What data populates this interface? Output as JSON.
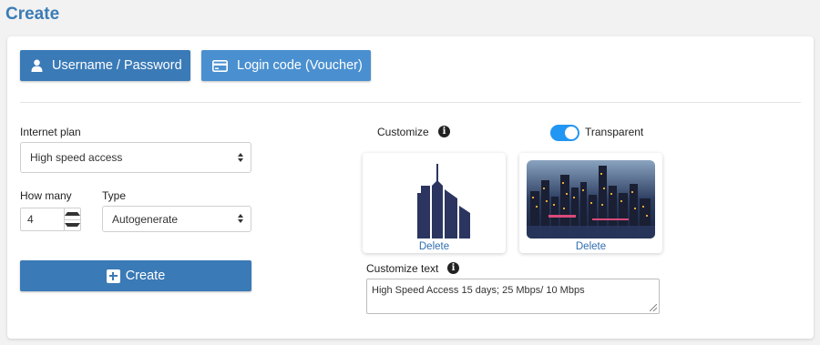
{
  "page": {
    "title": "Create"
  },
  "tabs": [
    {
      "label": "Username / Password",
      "icon": "user-icon"
    },
    {
      "label": "Login code (Voucher)",
      "icon": "credit-card-icon"
    }
  ],
  "form": {
    "plan_label": "Internet plan",
    "plan_value": "High speed access",
    "how_many_label": "How many",
    "how_many_value": "4",
    "type_label": "Type",
    "type_value": "Autogenerate",
    "create_label": "Create"
  },
  "customize": {
    "label": "Customize",
    "transparent_label": "Transparent",
    "transparent_on": true,
    "logo_delete": "Delete",
    "background_delete": "Delete",
    "text_label": "Customize text",
    "text_value": "High Speed Access 15 days; 25 Mbps/ 10 Mbps"
  },
  "colors": {
    "primary": "#3a7ab7",
    "secondary": "#4a90d0",
    "toggle": "#2196f3",
    "link": "#2f6eb0",
    "title": "#3c7bb5"
  }
}
